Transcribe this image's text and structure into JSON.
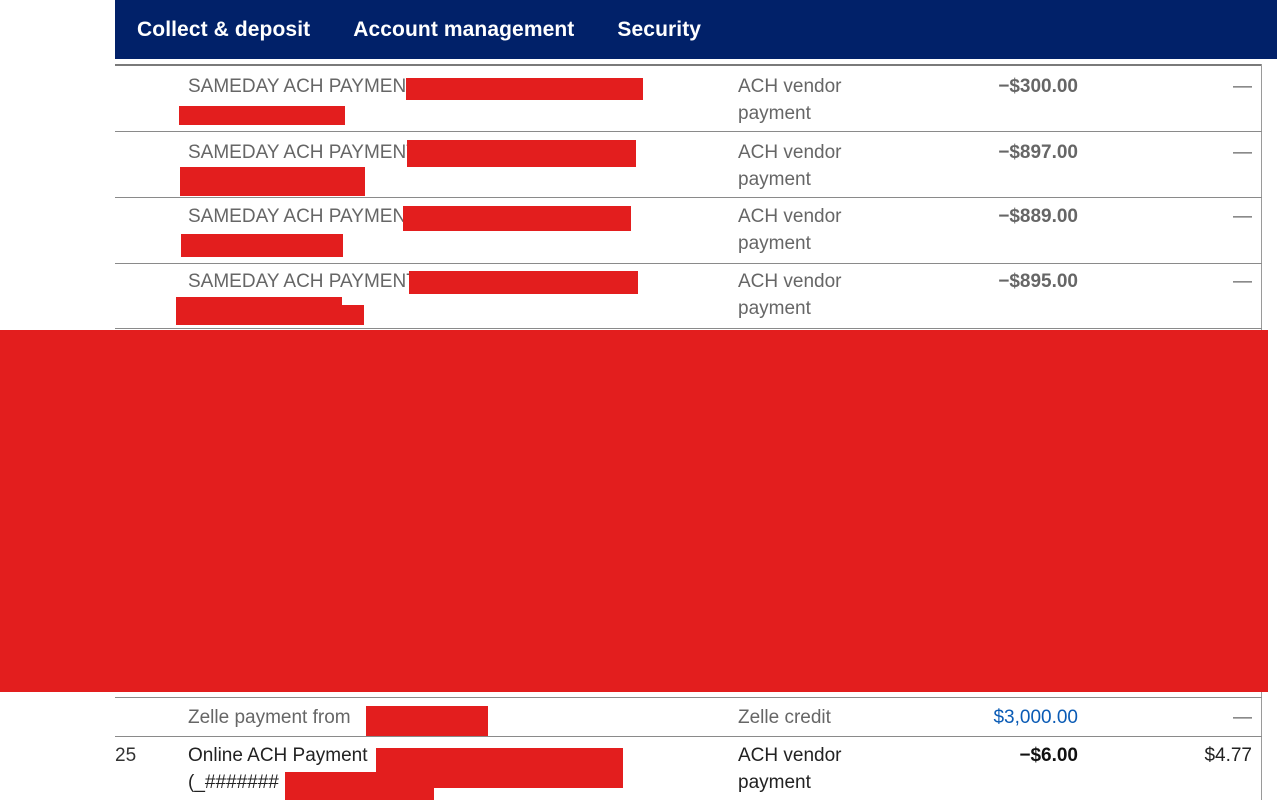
{
  "nav": {
    "items": [
      "Collect & deposit",
      "Account management",
      "Security"
    ],
    "background": "#012169"
  },
  "transactions": [
    {
      "date": "",
      "description": "SAMEDAY ACH PAYMENT",
      "type": "ACH vendor payment",
      "amount": "−$300.00",
      "balance": "—"
    },
    {
      "date": "",
      "description": "SAMEDAY ACH PAYMENT",
      "type": "ACH vendor payment",
      "amount": "−$897.00",
      "balance": "—"
    },
    {
      "date": "",
      "description": "SAMEDAY ACH PAYMENT",
      "type": "ACH vendor payment",
      "amount": "−$889.00",
      "balance": "—"
    },
    {
      "date": "",
      "description": "SAMEDAY ACH PAYMENT",
      "type": "ACH vendor payment",
      "amount": "−$895.00",
      "balance": "—"
    },
    {
      "date": "",
      "description": "Zelle payment from",
      "type": "Zelle credit",
      "amount": "$3,000.00",
      "balance": "—"
    },
    {
      "date": "25",
      "description": "Online ACH Payment",
      "description_line2": "(_#######",
      "type": "ACH vendor payment",
      "amount": "−$6.00",
      "balance": "$4.77"
    }
  ],
  "colors": {
    "credit": "#0a5bb5",
    "redaction": "#e31e1e"
  }
}
